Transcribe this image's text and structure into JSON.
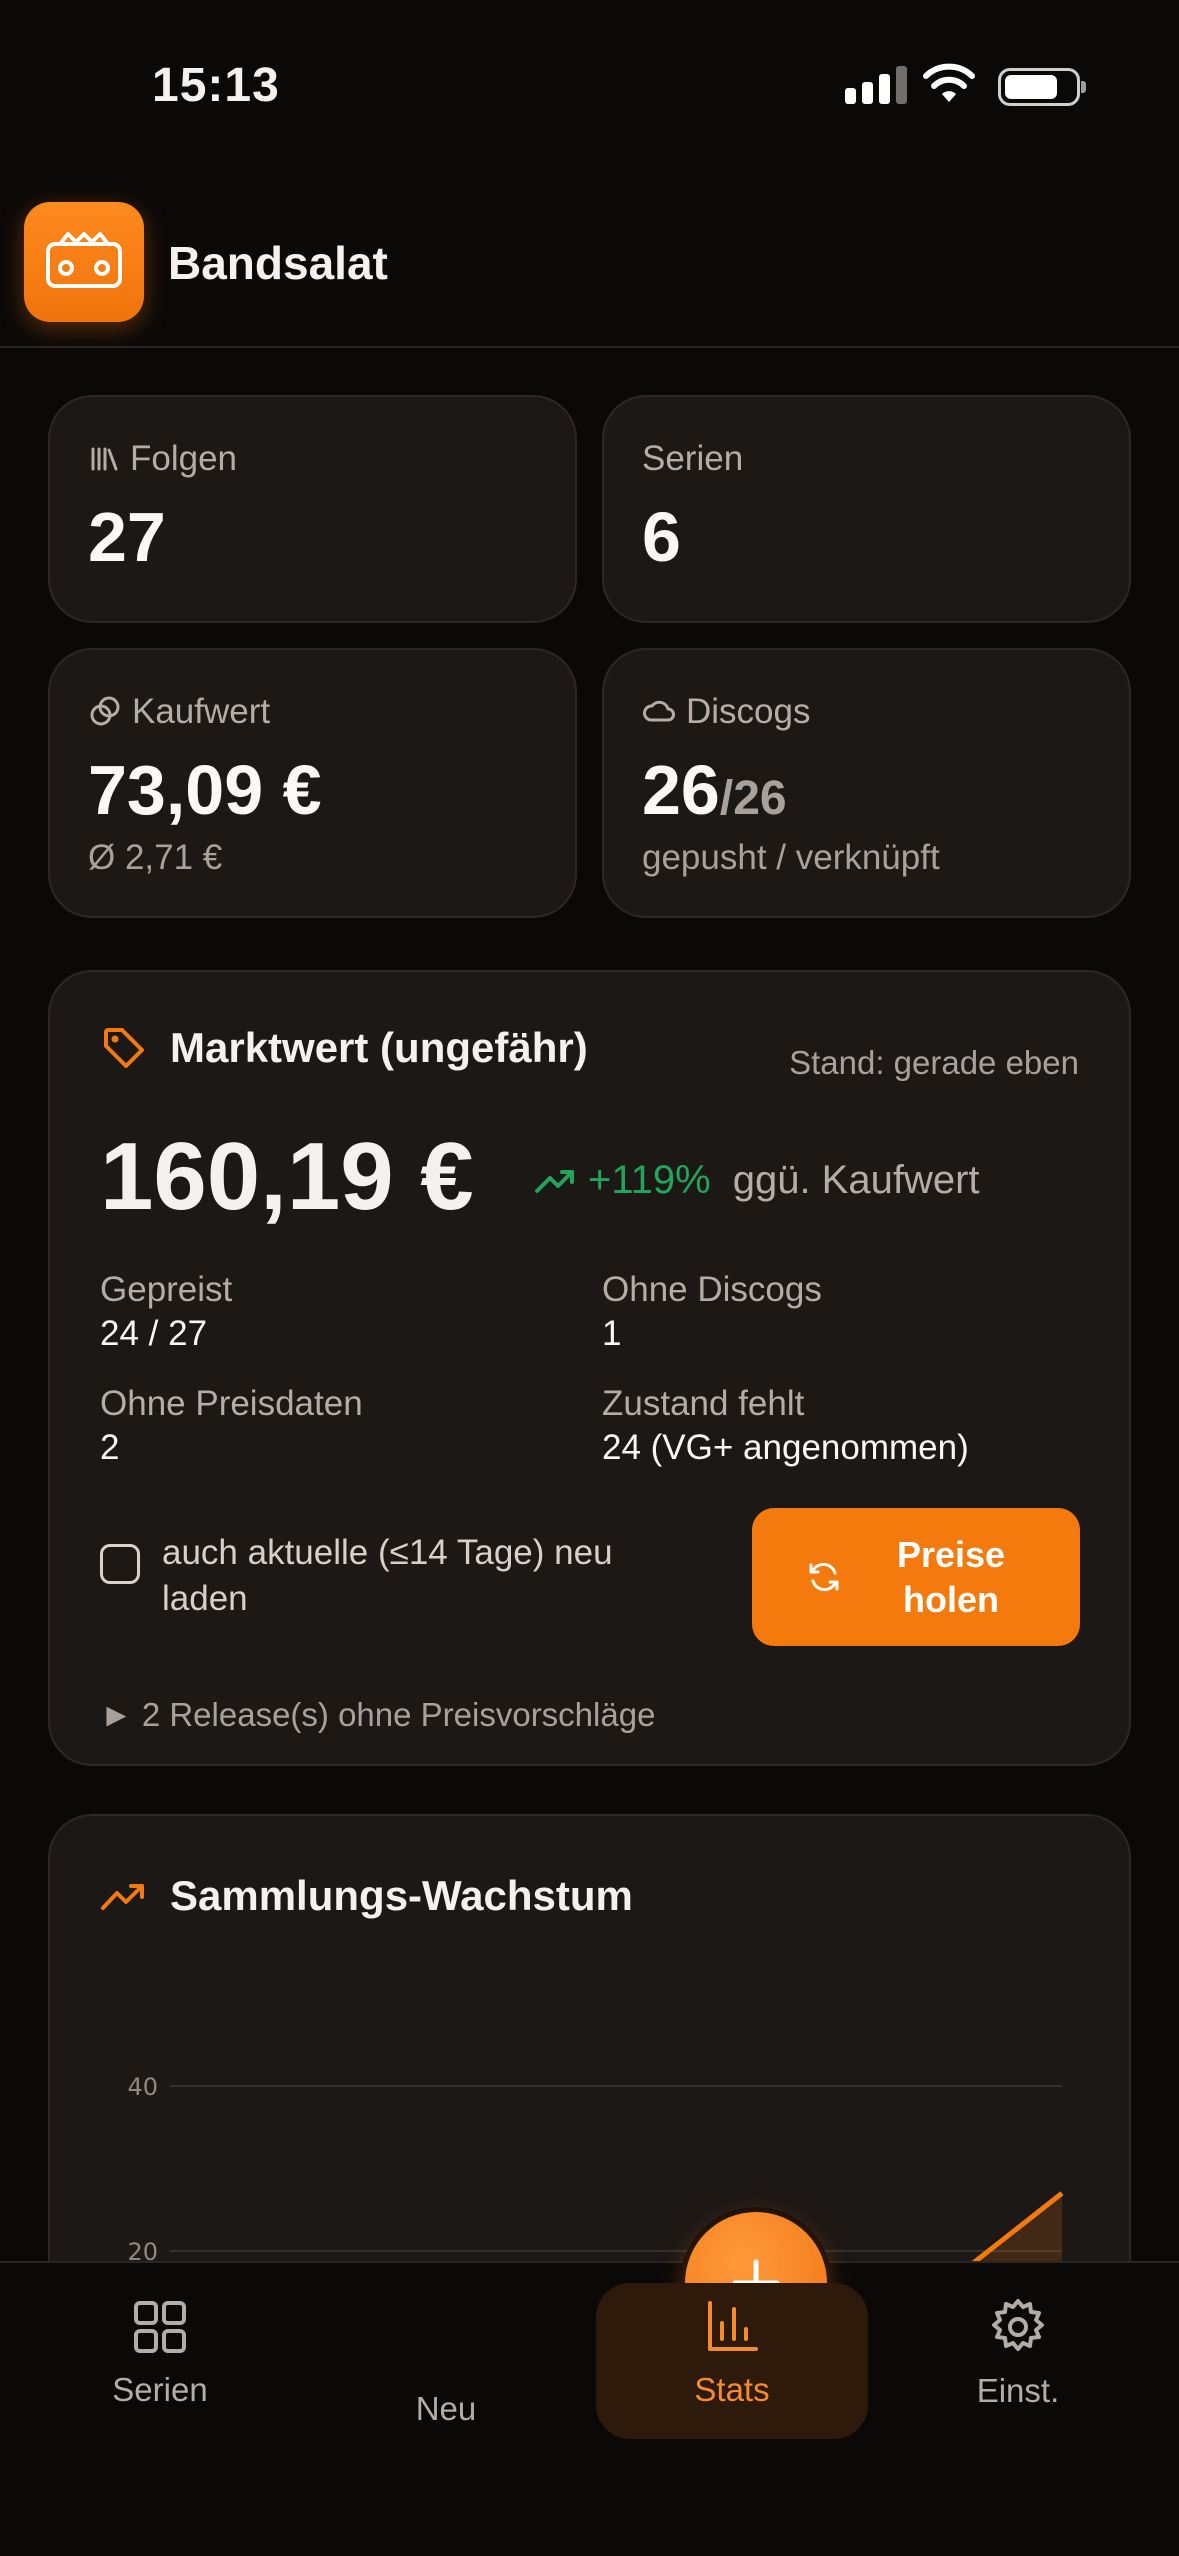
{
  "status_bar": {
    "time": "15:13"
  },
  "app": {
    "title": "Bandsalat",
    "logo_icon": "cassette-icon"
  },
  "stats": {
    "folgen": {
      "label": "Folgen",
      "value": "27"
    },
    "serien": {
      "label": "Serien",
      "value": "6"
    },
    "kaufwert": {
      "label": "Kaufwert",
      "value": "73,09 €",
      "sub": "Ø 2,71 €"
    },
    "discogs": {
      "label": "Discogs",
      "value": "26",
      "total": "/26",
      "sub": "gepusht / verknüpft"
    }
  },
  "marktwert": {
    "title": "Marktwert (ungefähr)",
    "stand": "Stand: gerade eben",
    "value": "160,19 €",
    "change": "+119%",
    "compare": "ggü. Kaufwert",
    "gepreist_label": "Gepreist",
    "gepreist_value": "24 / 27",
    "ohne_discogs_label": "Ohne Discogs",
    "ohne_discogs_value": "1",
    "ohne_preisdaten_label": "Ohne Preisdaten",
    "ohne_preisdaten_value": "2",
    "zustand_label": "Zustand fehlt",
    "zustand_value": "24 (VG+ angenommen)",
    "checkbox_label": "auch aktuelle (≤14 Tage) neu laden",
    "checkbox_checked": false,
    "button_label": "Preise holen",
    "release_note": "► 2 Release(s) ohne Preisvorschläge"
  },
  "wachstum": {
    "title": "Sammlungs-Wachstum"
  },
  "chart_data": {
    "type": "area",
    "title": "Sammlungs-Wachstum",
    "y_ticks": [
      "40",
      "20"
    ],
    "ylim": [
      0,
      40
    ],
    "x": [
      0.0,
      0.2,
      0.4,
      0.6,
      0.8,
      1.0
    ],
    "series": [
      {
        "values": [
          0,
          0,
          0,
          0,
          10,
          27
        ]
      }
    ],
    "grid": true,
    "color": "#f47a0e"
  },
  "nav": {
    "serien": "Serien",
    "neu": "Neu",
    "stats": "Stats",
    "einst": "Einst."
  },
  "colors": {
    "accent": "#f47a0e",
    "positive": "#22a45d",
    "card": "#1c1816",
    "background": "#0b0908"
  }
}
